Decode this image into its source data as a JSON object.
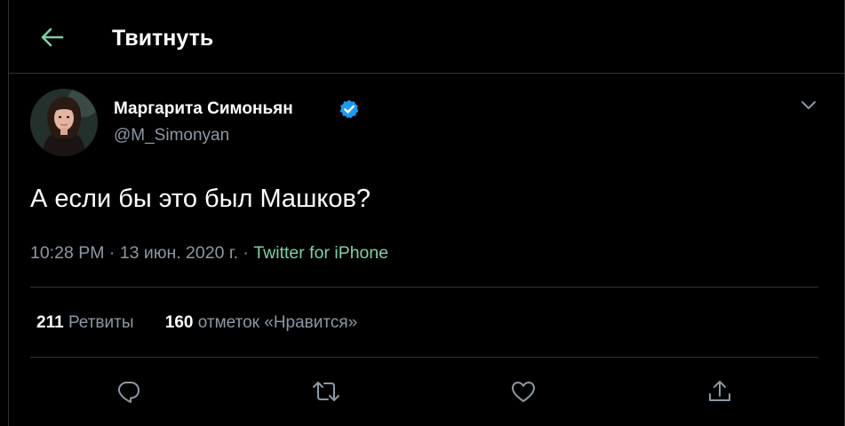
{
  "header": {
    "title": "Твитнуть",
    "back_icon": "arrow-left-icon",
    "accent": "#7ed0a6"
  },
  "tweet": {
    "author": {
      "name": "Маргарита Симоньян",
      "handle": "@M_Simonyan",
      "verified": true,
      "verified_color": "#1d9bf0",
      "avatar": "avatar-photo"
    },
    "text": "А если бы это был Машков?",
    "time": "10:28 PM",
    "date": "13 июн. 2020 г.",
    "separator": " · ",
    "source": "Twitter for iPhone",
    "source_color": "#7ed0a6",
    "stats": {
      "retweets_count": "211",
      "retweets_label": "Ретвиты",
      "likes_count": "160",
      "likes_label": "отметок «Нравится»"
    },
    "actions": [
      "reply-icon",
      "retweet-icon",
      "like-icon",
      "share-icon"
    ]
  }
}
